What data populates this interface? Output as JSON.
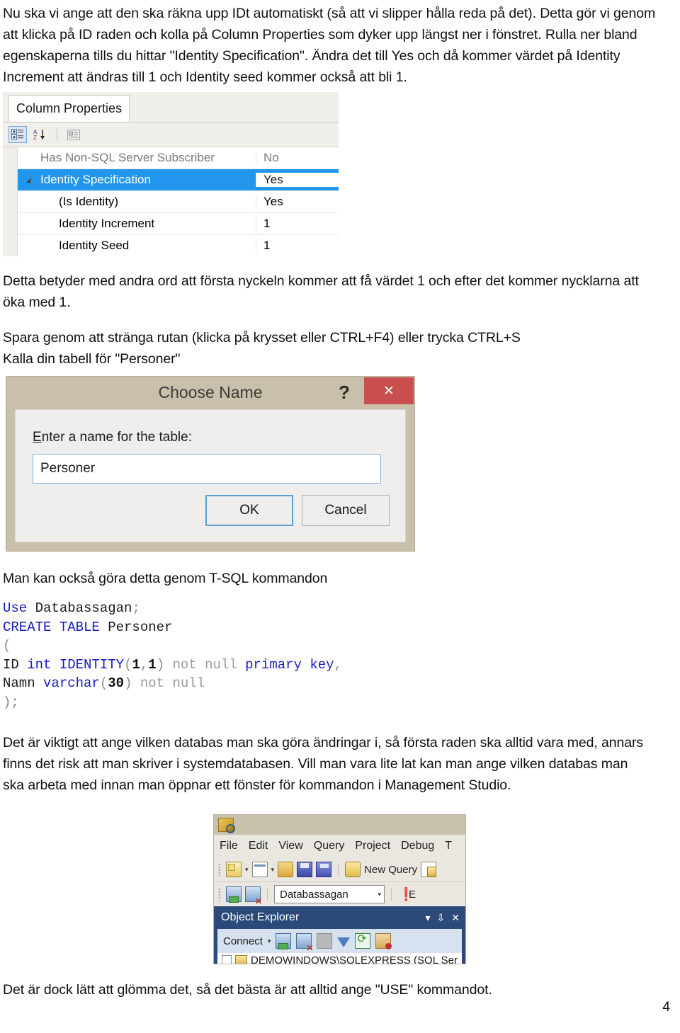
{
  "document": {
    "page_number": "4",
    "paragraphs": {
      "intro": "Nu ska vi ange att den ska räkna upp IDt automatiskt (så att vi slipper hålla reda på det). Detta gör vi genom att klicka på ID raden och kolla på Column Properties som dyker upp längst ner i fönstret. Rulla ner bland egenskaperna tills du hittar \"Identity Specification\". Ändra det till Yes och då kommer värdet på Identity Increment att ändras till 1 och Identity seed kommer också att bli 1.",
      "after_properties": "Detta betyder med andra ord att första nyckeln kommer att få värdet 1 och efter det kommer nycklarna att öka med 1.",
      "save_line1": "Spara genom att stränga rutan (klicka på krysset eller CTRL+F4) eller trycka CTRL+S",
      "save_line2": "Kalla din tabell för \"Personer\"",
      "tsql_intro": "Man kan också göra detta genom T-SQL kommandon",
      "after_code": "Det är viktigt att ange vilken databas man ska göra ändringar i, så första raden ska alltid vara med, annars finns det risk att man skriver i systemdatabasen. Vill man vara lite lat kan man ange vilken databas man ska arbeta med innan man öppnar ett fönster för kommandon i Management Studio.",
      "closing": "Det är dock lätt att glömma det, så det bästa är att alltid ange \"USE\" kommandot."
    }
  },
  "column_properties": {
    "tab_label": "Column Properties",
    "toolbar": {
      "categorized_icon": "categorized-view-icon",
      "alphabetical_icon": "alphabetical-sort-icon",
      "property_pages_icon": "property-pages-icon"
    },
    "selection_color": "#2196ec",
    "rows": [
      {
        "name": "Has Non-SQL Server Subscriber",
        "value": "No",
        "state": "disabled",
        "indent": 0,
        "expander": ""
      },
      {
        "name": "Identity Specification",
        "value": "Yes",
        "state": "selected",
        "indent": 0,
        "expander": "◢"
      },
      {
        "name": "(Is Identity)",
        "value": "Yes",
        "state": "normal",
        "indent": 1,
        "expander": ""
      },
      {
        "name": "Identity Increment",
        "value": "1",
        "state": "normal",
        "indent": 1,
        "expander": ""
      },
      {
        "name": "Identity Seed",
        "value": "1",
        "state": "normal",
        "indent": 1,
        "expander": ""
      }
    ]
  },
  "choose_name_dialog": {
    "title": "Choose Name",
    "help_glyph": "?",
    "close_glyph": "✕",
    "close_color": "#c94f4f",
    "titlebar_color": "#c8c0ab",
    "label_accesskey": "E",
    "label_rest": "nter a name for the table:",
    "input_value": "Personer",
    "ok_label": "OK",
    "cancel_label": "Cancel"
  },
  "sql_code": {
    "lines": [
      [
        {
          "t": "Use",
          "c": "kw"
        },
        {
          "t": " Databassagan",
          "c": "plain"
        },
        {
          "t": ";",
          "c": "punct"
        }
      ],
      [
        {
          "t": "CREATE TABLE",
          "c": "kw"
        },
        {
          "t": " Personer",
          "c": "plain"
        }
      ],
      [
        {
          "t": "(",
          "c": "punct"
        }
      ],
      [
        {
          "t": "ID ",
          "c": "plain"
        },
        {
          "t": "int",
          "c": "kw"
        },
        {
          "t": " ",
          "c": "plain"
        },
        {
          "t": "IDENTITY",
          "c": "kw"
        },
        {
          "t": "(",
          "c": "punct"
        },
        {
          "t": "1",
          "c": "num"
        },
        {
          "t": ",",
          "c": "punct"
        },
        {
          "t": "1",
          "c": "num"
        },
        {
          "t": ")",
          "c": "punct"
        },
        {
          "t": " ",
          "c": "plain"
        },
        {
          "t": "not null",
          "c": "dimtok"
        },
        {
          "t": " ",
          "c": "plain"
        },
        {
          "t": "primary key",
          "c": "kw"
        },
        {
          "t": ",",
          "c": "punct"
        }
      ],
      [
        {
          "t": "Namn ",
          "c": "plain"
        },
        {
          "t": "varchar",
          "c": "kw"
        },
        {
          "t": "(",
          "c": "punct"
        },
        {
          "t": "30",
          "c": "num"
        },
        {
          "t": ")",
          "c": "punct"
        },
        {
          "t": " ",
          "c": "plain"
        },
        {
          "t": "not null",
          "c": "dimtok"
        }
      ],
      [
        {
          "t": ")",
          "c": "punct"
        },
        {
          "t": ";",
          "c": "punct"
        }
      ]
    ],
    "keyword_color": "#1a1ac0",
    "dim_color": "#9a9a9a"
  },
  "ssms": {
    "menu_items": [
      "File",
      "Edit",
      "View",
      "Query",
      "Project",
      "Debug",
      "T"
    ],
    "new_query_label": "New Query",
    "database_selector_value": "Databassagan",
    "execute_label": "E",
    "object_explorer": {
      "title": "Object Explorer",
      "header_icons": [
        "chevron-down-icon",
        "pin-icon",
        "close-icon"
      ],
      "connect_label": "Connect",
      "toolbar_icons": [
        "connect-object-explorer-icon",
        "disconnect-object-explorer-icon",
        "stop-icon",
        "filter-icon",
        "refresh-icon",
        "activity-monitor-icon"
      ],
      "tree_root": "DEMOWINDOWS\\SQLEXPRESS (SQL Ser"
    }
  }
}
